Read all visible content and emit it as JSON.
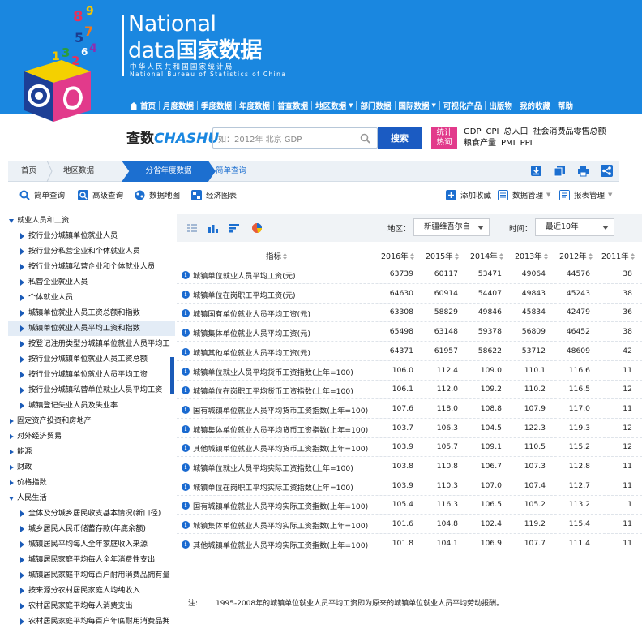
{
  "header": {
    "brand_en_1": "National",
    "brand_en_2": "data",
    "brand_cn": "国家数据",
    "org_cn": "中华人民共和国国家统计局",
    "org_en": "National Bureau of Statistics of China",
    "logo_digits": [
      "8",
      "9",
      "5",
      "7",
      "1",
      "3",
      "4",
      "2",
      "6"
    ],
    "bg_color": "#1a87e0"
  },
  "nav": {
    "items": [
      "首页",
      "月度数据",
      "季度数据",
      "年度数据",
      "普查数据",
      "地区数据",
      "部门数据",
      "国际数据",
      "可视化产品",
      "出版物",
      "我的收藏",
      "帮助"
    ]
  },
  "search": {
    "brand_cn": "查数",
    "brand_en": "CHASHU",
    "placeholder": "如：2012年 北京 GDP",
    "button": "搜索",
    "hot_label_1": "统计",
    "hot_label_2": "热词",
    "hot_words_line1": [
      "GDP",
      "CPI",
      "总人口",
      "社会消费品零售总额"
    ],
    "hot_words_line2": [
      "粮食产量",
      "PMI",
      "PPI"
    ]
  },
  "breadcrumb": {
    "items": [
      "首页",
      "地区数据",
      "分省年度数据",
      "简单查询"
    ]
  },
  "toolbar": {
    "simple_query": "简单查询",
    "advanced_query": "高级查询",
    "data_map": "数据地图",
    "econ_chart": "经济图表",
    "add_fav": "添加收藏",
    "data_manage": "数据管理",
    "report_manage": "报表管理"
  },
  "sidebar": {
    "items": [
      {
        "level": "top",
        "open": true,
        "label": "就业人员和工资"
      },
      {
        "level": "sub",
        "label": "按行业分城镇单位就业人员"
      },
      {
        "level": "sub",
        "label": "按行业分私营企业和个体就业人员"
      },
      {
        "level": "sub",
        "label": "按行业分城镇私营企业和个体就业人员"
      },
      {
        "level": "sub",
        "label": "私营企业就业人员"
      },
      {
        "level": "sub",
        "label": "个体就业人员"
      },
      {
        "level": "sub",
        "label": "城镇单位就业人员工资总额和指数"
      },
      {
        "level": "sub",
        "selected": true,
        "label": "城镇单位就业人员平均工资和指数"
      },
      {
        "level": "sub",
        "label": "按登记注册类型分城镇单位就业人员平均工"
      },
      {
        "level": "sub",
        "label": "按行业分城镇单位就业人员工资总额"
      },
      {
        "level": "sub",
        "label": "按行业分城镇单位就业人员平均工资"
      },
      {
        "level": "sub",
        "label": "按行业分城镇私营单位就业人员平均工资"
      },
      {
        "level": "sub",
        "label": "城镇登记失业人员及失业率"
      },
      {
        "level": "top",
        "label": "固定资产投资和房地产"
      },
      {
        "level": "top",
        "label": "对外经济贸易"
      },
      {
        "level": "top",
        "label": "能源"
      },
      {
        "level": "top",
        "label": "财政"
      },
      {
        "level": "top",
        "label": "价格指数"
      },
      {
        "level": "top",
        "open": true,
        "label": "人民生活"
      },
      {
        "level": "sub",
        "label": "全体及分城乡居民收支基本情况(新口径)"
      },
      {
        "level": "sub",
        "label": "城乡居民人民币储蓄存款(年底余额)"
      },
      {
        "level": "sub",
        "label": "城镇居民平均每人全年家庭收入来源"
      },
      {
        "level": "sub",
        "label": "城镇居民家庭平均每人全年消费性支出"
      },
      {
        "level": "sub",
        "label": "城镇居民家庭平均每百户耐用消费品拥有量"
      },
      {
        "level": "sub",
        "label": "按来源分农村居民家庭人均纯收入"
      },
      {
        "level": "sub",
        "label": "农村居民家庭平均每人消费支出"
      },
      {
        "level": "sub",
        "label": "农村居民家庭平均每百户年底耐用消费品拥"
      }
    ]
  },
  "filters": {
    "region_label": "地区：",
    "region_value": "新疆维吾尔自",
    "time_label": "时间：",
    "time_value": "最近10年"
  },
  "table": {
    "indicator_header": "指标",
    "years": [
      "2016年",
      "2015年",
      "2014年",
      "2013年",
      "2012年",
      "2011年"
    ],
    "rows": [
      {
        "name": "城镇单位就业人员平均工资(元)",
        "values": [
          "63739",
          "60117",
          "53471",
          "49064",
          "44576",
          "38"
        ]
      },
      {
        "name": "城镇单位在岗职工平均工资(元)",
        "values": [
          "64630",
          "60914",
          "54407",
          "49843",
          "45243",
          "38"
        ]
      },
      {
        "name": "城镇国有单位就业人员平均工资(元)",
        "values": [
          "63308",
          "58829",
          "49846",
          "45834",
          "42479",
          "36"
        ]
      },
      {
        "name": "城镇集体单位就业人员平均工资(元)",
        "values": [
          "65498",
          "63148",
          "59378",
          "56809",
          "46452",
          "38"
        ]
      },
      {
        "name": "城镇其他单位就业人员平均工资(元)",
        "values": [
          "64371",
          "61957",
          "58622",
          "53712",
          "48609",
          "42"
        ]
      },
      {
        "name": "城镇单位就业人员平均货币工资指数(上年=100)",
        "values": [
          "106.0",
          "112.4",
          "109.0",
          "110.1",
          "116.6",
          "11"
        ]
      },
      {
        "name": "城镇单位在岗职工平均货币工资指数(上年=100)",
        "values": [
          "106.1",
          "112.0",
          "109.2",
          "110.2",
          "116.5",
          "12"
        ]
      },
      {
        "name": "国有城镇单位就业人员平均货币工资指数(上年=100)",
        "values": [
          "107.6",
          "118.0",
          "108.8",
          "107.9",
          "117.0",
          "11"
        ]
      },
      {
        "name": "城镇集体单位就业人员平均货币工资指数(上年=100)",
        "values": [
          "103.7",
          "106.3",
          "104.5",
          "122.3",
          "119.3",
          "12"
        ]
      },
      {
        "name": "其他城镇单位就业人员平均货币工资指数(上年=100)",
        "values": [
          "103.9",
          "105.7",
          "109.1",
          "110.5",
          "115.2",
          "12"
        ]
      },
      {
        "name": "城镇单位就业人员平均实际工资指数(上年=100)",
        "values": [
          "103.8",
          "110.8",
          "106.7",
          "107.3",
          "112.8",
          "11"
        ]
      },
      {
        "name": "城镇单位在岗职工平均实际工资指数(上年=100)",
        "values": [
          "103.9",
          "110.3",
          "107.0",
          "107.4",
          "112.7",
          "11"
        ]
      },
      {
        "name": "国有城镇单位就业人员平均实际工资指数(上年=100)",
        "values": [
          "105.4",
          "116.3",
          "106.5",
          "105.2",
          "113.2",
          "1"
        ]
      },
      {
        "name": "城镇集体单位就业人员平均实际工资指数(上年=100)",
        "values": [
          "101.6",
          "104.8",
          "102.4",
          "119.2",
          "115.4",
          "11"
        ]
      },
      {
        "name": "其他城镇单位就业人员平均实际工资指数(上年=100)",
        "values": [
          "101.8",
          "104.1",
          "106.9",
          "107.7",
          "111.4",
          "11"
        ]
      }
    ]
  },
  "note": {
    "label": "注:",
    "text": "1995-2008年的城镇单位就业人员平均工资即为原来的城镇单位就业人员平均劳动报酬。"
  }
}
